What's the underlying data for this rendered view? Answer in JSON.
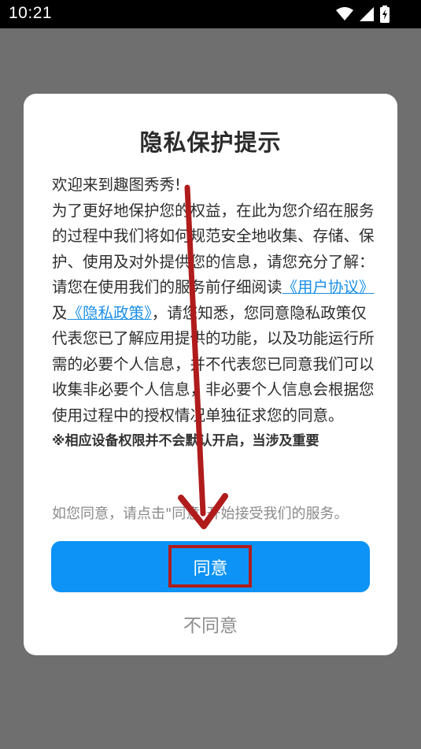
{
  "status_bar": {
    "time": "10:21",
    "icons": [
      "wifi-icon",
      "cellular-icon",
      "battery-charging-icon"
    ]
  },
  "dialog": {
    "title": "隐私保护提示",
    "paragraphs": {
      "welcome": "欢迎来到趣图秀秀!",
      "intro": "为了更好地保护您的权益，在此为您介绍在服务的过程中我们将如何规范安全地收集、存储、保护、使用及对外提供您的信息，请您充分了解：",
      "read_prefix": "请您在使用我们的服务前仔细阅读",
      "user_agreement_link": "《用户协议》",
      "and": "及",
      "privacy_policy_link": "《隐私政策》",
      "read_suffix": "，请您知悉，您同意隐私政策仅代表您已了解应用提供的功能，以及功能运行所需的必要个人信息，并不代表您已同意我们可以收集非必要个人信息，非必要个人信息会根据您使用过程中的授权情况单独征求您的同意。",
      "note": "※相应设备权限并不会默认开启，当涉及重要"
    },
    "hint": "如您同意，请点击\"同意\"开始接受我们的服务。",
    "agree_label": "同意",
    "disagree_label": "不同意"
  },
  "colors": {
    "primary": "#0d93f5",
    "link": "#1a8fe6",
    "annotation": "#b01c1c",
    "overlay": "#6f6f6f"
  }
}
